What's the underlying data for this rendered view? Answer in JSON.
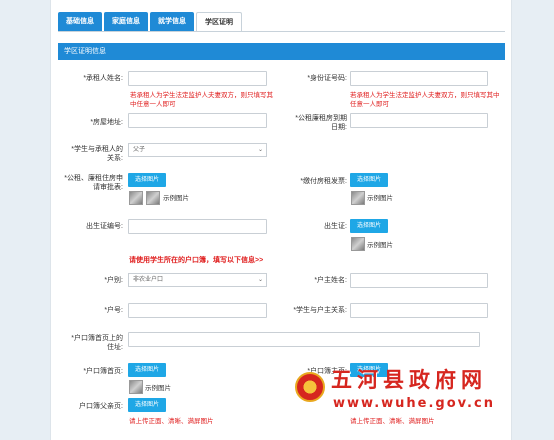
{
  "tabs": [
    {
      "label": "基础信息"
    },
    {
      "label": "家庭信息"
    },
    {
      "label": "就学信息"
    },
    {
      "label": "学区证明"
    }
  ],
  "section_title": "学区证明信息",
  "fields": {
    "renter_name": {
      "label": "*承租人姓名:",
      "value": ""
    },
    "id_number": {
      "label": "*身份证号码:",
      "value": ""
    },
    "owner_warning": "若承租人为学生法定监护人夫妻双方，则只填写其中任意一人即可",
    "id_warning": "若承租人为学生法定监护人夫妻双方，则只填写其中任意一人即可",
    "house_address": {
      "label": "*房屋地址:",
      "value": ""
    },
    "lease_expiry": {
      "label": "*公租廉租房到期日期:",
      "value": ""
    },
    "relation_to_renter": {
      "label": "*学生与承租人的关系:",
      "value": "父子"
    },
    "lease_doc": {
      "label": "*公租、廉租住房申请审批表:"
    },
    "rent_invoice": {
      "label": "*缴付房租发票:"
    },
    "birth_cert_no": {
      "label": "出生证编号:",
      "value": ""
    },
    "birth_cert": {
      "label": "出生证:"
    },
    "hukou_type": {
      "label": "*户别:",
      "value": "非农业户口"
    },
    "householder_name": {
      "label": "*户主姓名:",
      "value": ""
    },
    "hukou_no": {
      "label": "*户号:",
      "value": ""
    },
    "relation_to_householder": {
      "label": "*学生与户主关系:",
      "value": ""
    },
    "hukou_address": {
      "label": "*户口簿首页上的住址:",
      "value": ""
    },
    "hukou_first_page": {
      "label": "*户口簿首页:"
    },
    "householder_page": {
      "label": "*户口簿主页:"
    },
    "hukou_parent_page": {
      "label": "户口簿父亲页:"
    }
  },
  "buttons": {
    "choose_image": "选择图片"
  },
  "sample_label": "示例图片",
  "hukou_note": "请使用学生所在的户口簿，填写以下信息>>",
  "upload_warning": "请上传正面、清晰、满屏图片",
  "watermark": {
    "title": "五河县政府网",
    "url": "www.wuhe.gov.cn"
  }
}
